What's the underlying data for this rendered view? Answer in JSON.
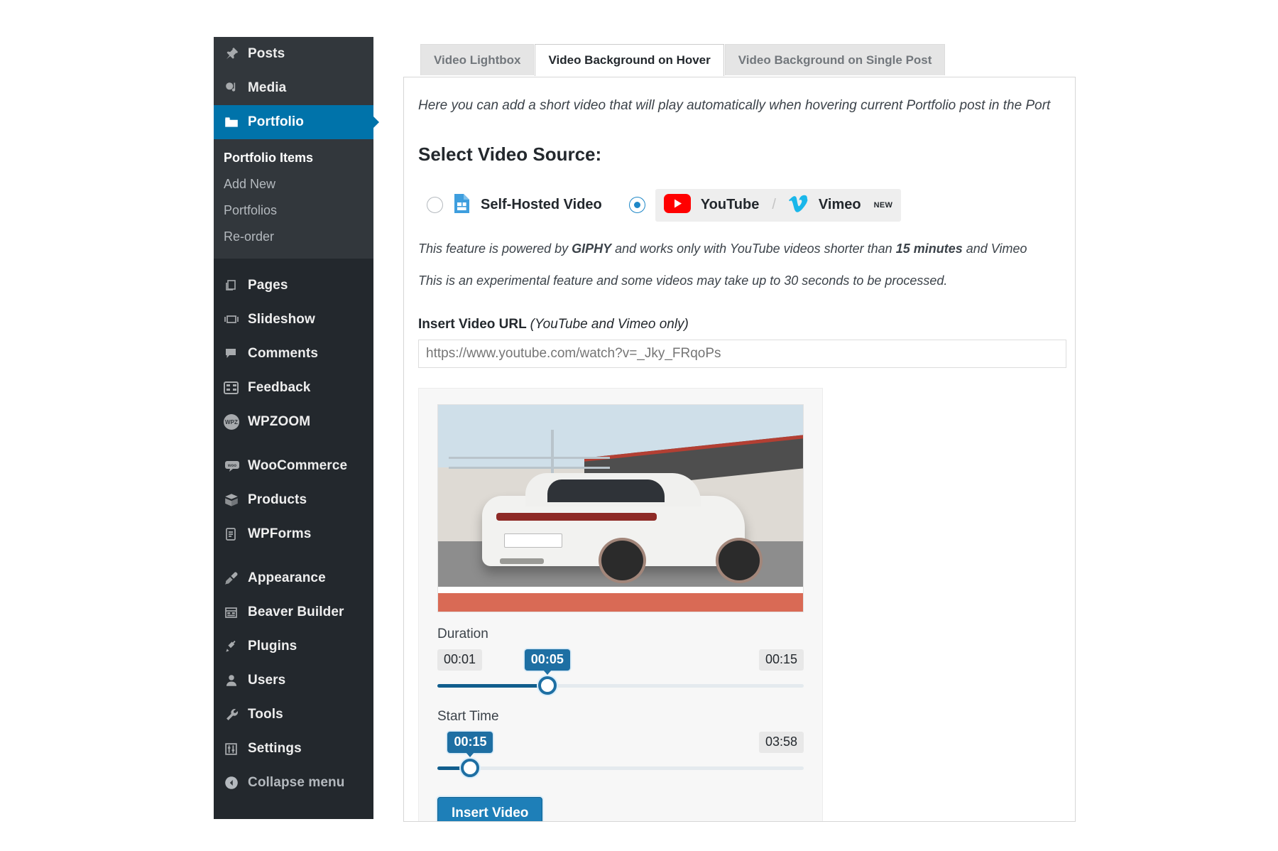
{
  "sidebar": {
    "items": [
      {
        "label": "Posts",
        "icon": "pin-icon",
        "state": "normal"
      },
      {
        "label": "Media",
        "icon": "media-icon",
        "state": "normal"
      },
      {
        "label": "Portfolio",
        "icon": "portfolio-folder-icon",
        "state": "current"
      }
    ],
    "submenu": [
      {
        "label": "Portfolio Items",
        "active": true
      },
      {
        "label": "Add New",
        "active": false
      },
      {
        "label": "Portfolios",
        "active": false
      },
      {
        "label": "Re-order",
        "active": false
      }
    ],
    "group2": [
      {
        "label": "Pages",
        "icon": "pages-icon"
      },
      {
        "label": "Slideshow",
        "icon": "slideshow-icon"
      },
      {
        "label": "Comments",
        "icon": "comment-icon"
      },
      {
        "label": "Feedback",
        "icon": "feedback-icon"
      },
      {
        "label": "WPZOOM",
        "icon": "wpzoom-icon"
      }
    ],
    "group3": [
      {
        "label": "WooCommerce",
        "icon": "woocommerce-icon"
      },
      {
        "label": "Products",
        "icon": "products-box-icon"
      },
      {
        "label": "WPForms",
        "icon": "wpforms-icon"
      }
    ],
    "group4": [
      {
        "label": "Appearance",
        "icon": "appearance-brush-icon"
      },
      {
        "label": "Beaver Builder",
        "icon": "beaver-builder-icon"
      },
      {
        "label": "Plugins",
        "icon": "plugin-icon"
      },
      {
        "label": "Users",
        "icon": "user-icon"
      },
      {
        "label": "Tools",
        "icon": "wrench-icon"
      },
      {
        "label": "Settings",
        "icon": "settings-sliders-icon"
      }
    ],
    "collapse": {
      "label": "Collapse menu",
      "icon": "collapse-arrow-icon"
    }
  },
  "tabs": [
    {
      "label": "Video Lightbox",
      "active": false
    },
    {
      "label": "Video Background on Hover",
      "active": true
    },
    {
      "label": "Video Background on Single Post",
      "active": false
    }
  ],
  "panel": {
    "intro": "Here you can add a short video that will play automatically when hovering current Portfolio post in the Port",
    "section_title": "Select Video Source:",
    "sources": [
      {
        "label": "Self-Hosted Video",
        "icon": "video-file-icon",
        "selected": false
      },
      {
        "label": "YouTube",
        "icon": "youtube-icon",
        "selected": true
      },
      {
        "label": "Vimeo",
        "icon": "vimeo-icon",
        "selected": true,
        "badge": "NEW"
      }
    ],
    "source_separator": "/",
    "note_1": {
      "part1": "This feature is powered by ",
      "bold1": "GIPHY",
      "part2": " and works only with YouTube videos shorter than ",
      "bold2": "15 minutes",
      "part3": " and Vimeo"
    },
    "note_2": "This is an experimental feature and some videos may take up to 30 seconds to be processed.",
    "url_field": {
      "label": "Insert Video URL",
      "label_hint": "(YouTube and Vimeo only)",
      "placeholder": "https://www.youtube.com/watch?v=_Jky_FRqoPs",
      "value": ""
    },
    "video_tool": {
      "thumbnail_alt": "white-sports-car-video-thumbnail",
      "duration": {
        "label": "Duration",
        "min": "00:01",
        "value": "00:05",
        "max": "00:15",
        "fill_percent": 30
      },
      "start_time": {
        "label": "Start Time",
        "value": "00:15",
        "max": "03:58",
        "fill_percent": 9
      },
      "insert_button": "Insert Video"
    }
  },
  "colors": {
    "admin_bg": "#23282d",
    "admin_submenu_bg": "#32373c",
    "accent_blue": "#0073aa",
    "slider_blue": "#1e6fa3",
    "button_blue": "#1e7fb8",
    "youtube_red": "#ff0000",
    "vimeo_blue": "#1ab7ea"
  }
}
